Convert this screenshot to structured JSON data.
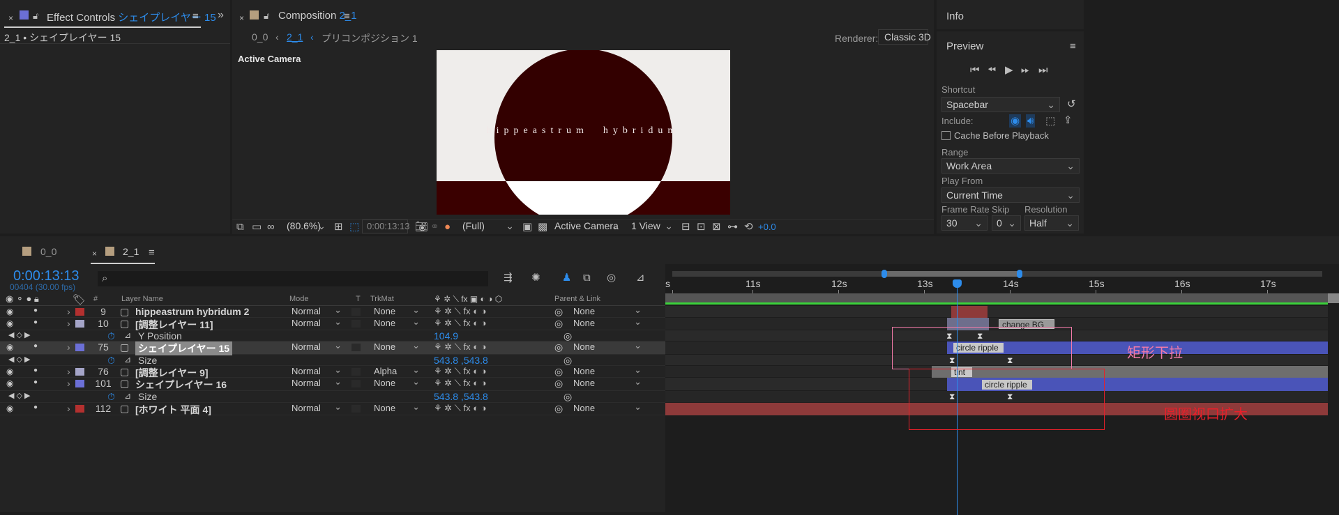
{
  "effect_controls": {
    "title_prefix": "Effect Controls",
    "title_layer": "シェイプレイヤー 15",
    "breadcrumb": "2_1 • シェイプレイヤー 15"
  },
  "composition": {
    "title_prefix": "Composition",
    "title_name": "2_1",
    "nav_root": "0_0",
    "nav_current": "2_1",
    "nav_precomp": "プリコンポジション 1",
    "renderer_label": "Renderer:",
    "renderer_value": "Classic 3D",
    "active_camera_label": "Active Camera",
    "canvas_text": "hippeastrum  hybridum",
    "zoom": "(80.6%)",
    "timecode": "0:00:13:13",
    "resolution": "(Full)",
    "camera": "Active Camera",
    "views": "1 View",
    "exposure": "+0.0"
  },
  "info": {
    "title": "Info"
  },
  "preview": {
    "title": "Preview",
    "shortcut_label": "Shortcut",
    "shortcut_value": "Spacebar",
    "include_label": "Include:",
    "cache_label": "Cache Before Playback",
    "range_label": "Range",
    "range_value": "Work Area",
    "playfrom_label": "Play From",
    "playfrom_value": "Current Time",
    "framerate_label": "Frame Rate",
    "framerate_value": "30",
    "skip_label": "Skip",
    "skip_value": "0",
    "resolution_label": "Resolution",
    "resolution_value": "Half"
  },
  "timeline": {
    "tabs": [
      "0_0",
      "2_1"
    ],
    "timecode": "0:00:13:13",
    "frames": "00404 (30.00 fps)",
    "search_placeholder": "",
    "headers": {
      "layer_name": "Layer Name",
      "mode": "Mode",
      "t": "T",
      "trkmat": "TrkMat",
      "parent": "Parent & Link",
      "num": "#"
    },
    "ruler": [
      "s",
      "11s",
      "12s",
      "13s",
      "14s",
      "15s",
      "16s",
      "17s"
    ],
    "layers": [
      {
        "num": "9",
        "name": "hippeastrum hybridum 2",
        "mode": "Normal",
        "trkmat": "None",
        "parent": "None",
        "color": "#b3302f"
      },
      {
        "num": "10",
        "name": "[調整レイヤー 11]",
        "mode": "Normal",
        "trkmat": "None",
        "parent": "None",
        "color": "#a5a5c8"
      },
      {
        "prop": "Y Position",
        "value": "104.9"
      },
      {
        "num": "75",
        "name": "シェイプレイヤー 15",
        "mode": "Normal",
        "trkmat": "None",
        "parent": "None",
        "color": "#6b6fd6"
      },
      {
        "prop": "Size",
        "value": "543.8 ,543.8"
      },
      {
        "num": "76",
        "name": "[調整レイヤー 9]",
        "mode": "Normal",
        "trkmat": "Alpha",
        "parent": "None",
        "color": "#a5a5c8"
      },
      {
        "num": "101",
        "name": "シェイプレイヤー 16",
        "mode": "Normal",
        "trkmat": "None",
        "parent": "None",
        "color": "#6b6fd6"
      },
      {
        "prop": "Size",
        "value": "543.8 ,543.8"
      },
      {
        "num": "112",
        "name": "[ホワイト 平面 4]",
        "mode": "Normal",
        "trkmat": "None",
        "parent": "None",
        "color": "#b3302f"
      }
    ],
    "markers": {
      "change_bg": "change BG",
      "circle_ripple_1": "circle ripple",
      "tint": "tint",
      "circle_ripple_2": "circle ripple"
    },
    "annotations": {
      "pink": "矩形下拉",
      "red": "圆圈视口扩大"
    }
  },
  "colors": {
    "accent": "#2d8ceb",
    "annot_pink": "#f27aa8",
    "annot_red": "#e8202a",
    "canvas_dark": "#330000",
    "canvas_light": "#efedeb"
  }
}
